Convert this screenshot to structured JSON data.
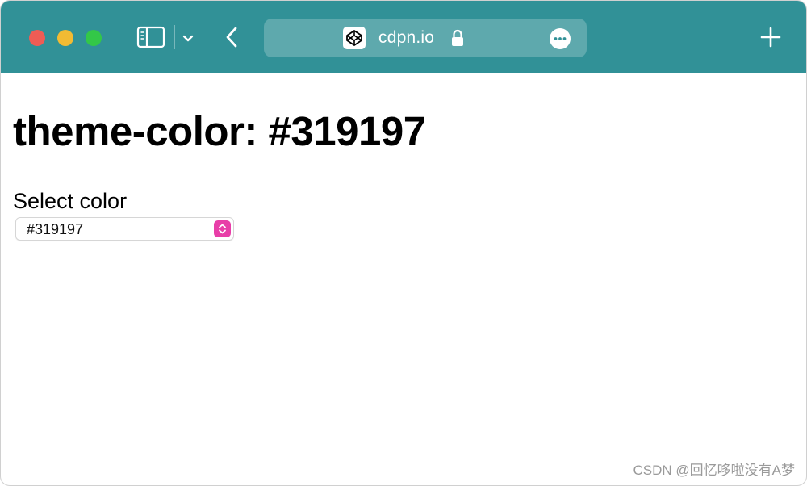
{
  "browser": {
    "address_bar": {
      "url": "cdpn.io",
      "favicon": "codepen-icon",
      "secure": true
    },
    "toolbar_color": "#319197"
  },
  "page": {
    "title": "theme-color: #319197",
    "select_label": "Select color",
    "select": {
      "value": "#319197",
      "accent_color": "#e83ea8"
    }
  },
  "watermark": "CSDN @回忆哆啦没有A梦"
}
